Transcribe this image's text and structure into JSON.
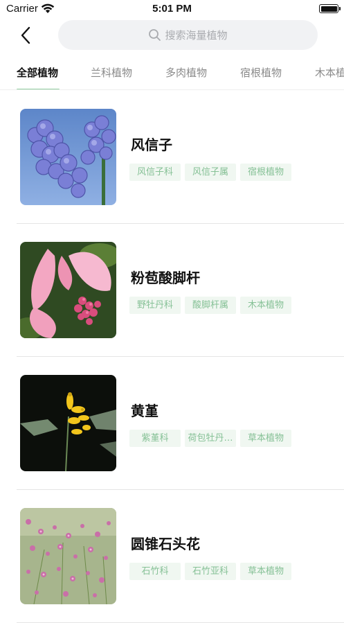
{
  "status_bar": {
    "carrier": "Carrier",
    "time": "5:01 PM"
  },
  "search": {
    "placeholder": "搜索海量植物"
  },
  "tabs": [
    {
      "label": "全部植物",
      "active": true
    },
    {
      "label": "兰科植物",
      "active": false
    },
    {
      "label": "多肉植物",
      "active": false
    },
    {
      "label": "宿根植物",
      "active": false
    },
    {
      "label": "木本植物",
      "active": false
    }
  ],
  "plants": [
    {
      "name": "风信子",
      "tags": [
        "风信子科",
        "风信子属",
        "宿根植物"
      ],
      "image": "hyacinth-photo"
    },
    {
      "name": "粉苞酸脚杆",
      "tags": [
        "野牡丹科",
        "酸脚杆属",
        "木本植物"
      ],
      "image": "medinilla-photo"
    },
    {
      "name": "黄堇",
      "tags": [
        "紫堇科",
        "荷包牡丹…",
        "草本植物"
      ],
      "image": "corydalis-photo"
    },
    {
      "name": "圆锥石头花",
      "tags": [
        "石竹科",
        "石竹亚科",
        "草本植物"
      ],
      "image": "gypsophila-photo"
    }
  ],
  "colors": {
    "accent": "#8fce9f",
    "tag_bg": "#f0f7f1",
    "tag_text": "#86c196"
  }
}
